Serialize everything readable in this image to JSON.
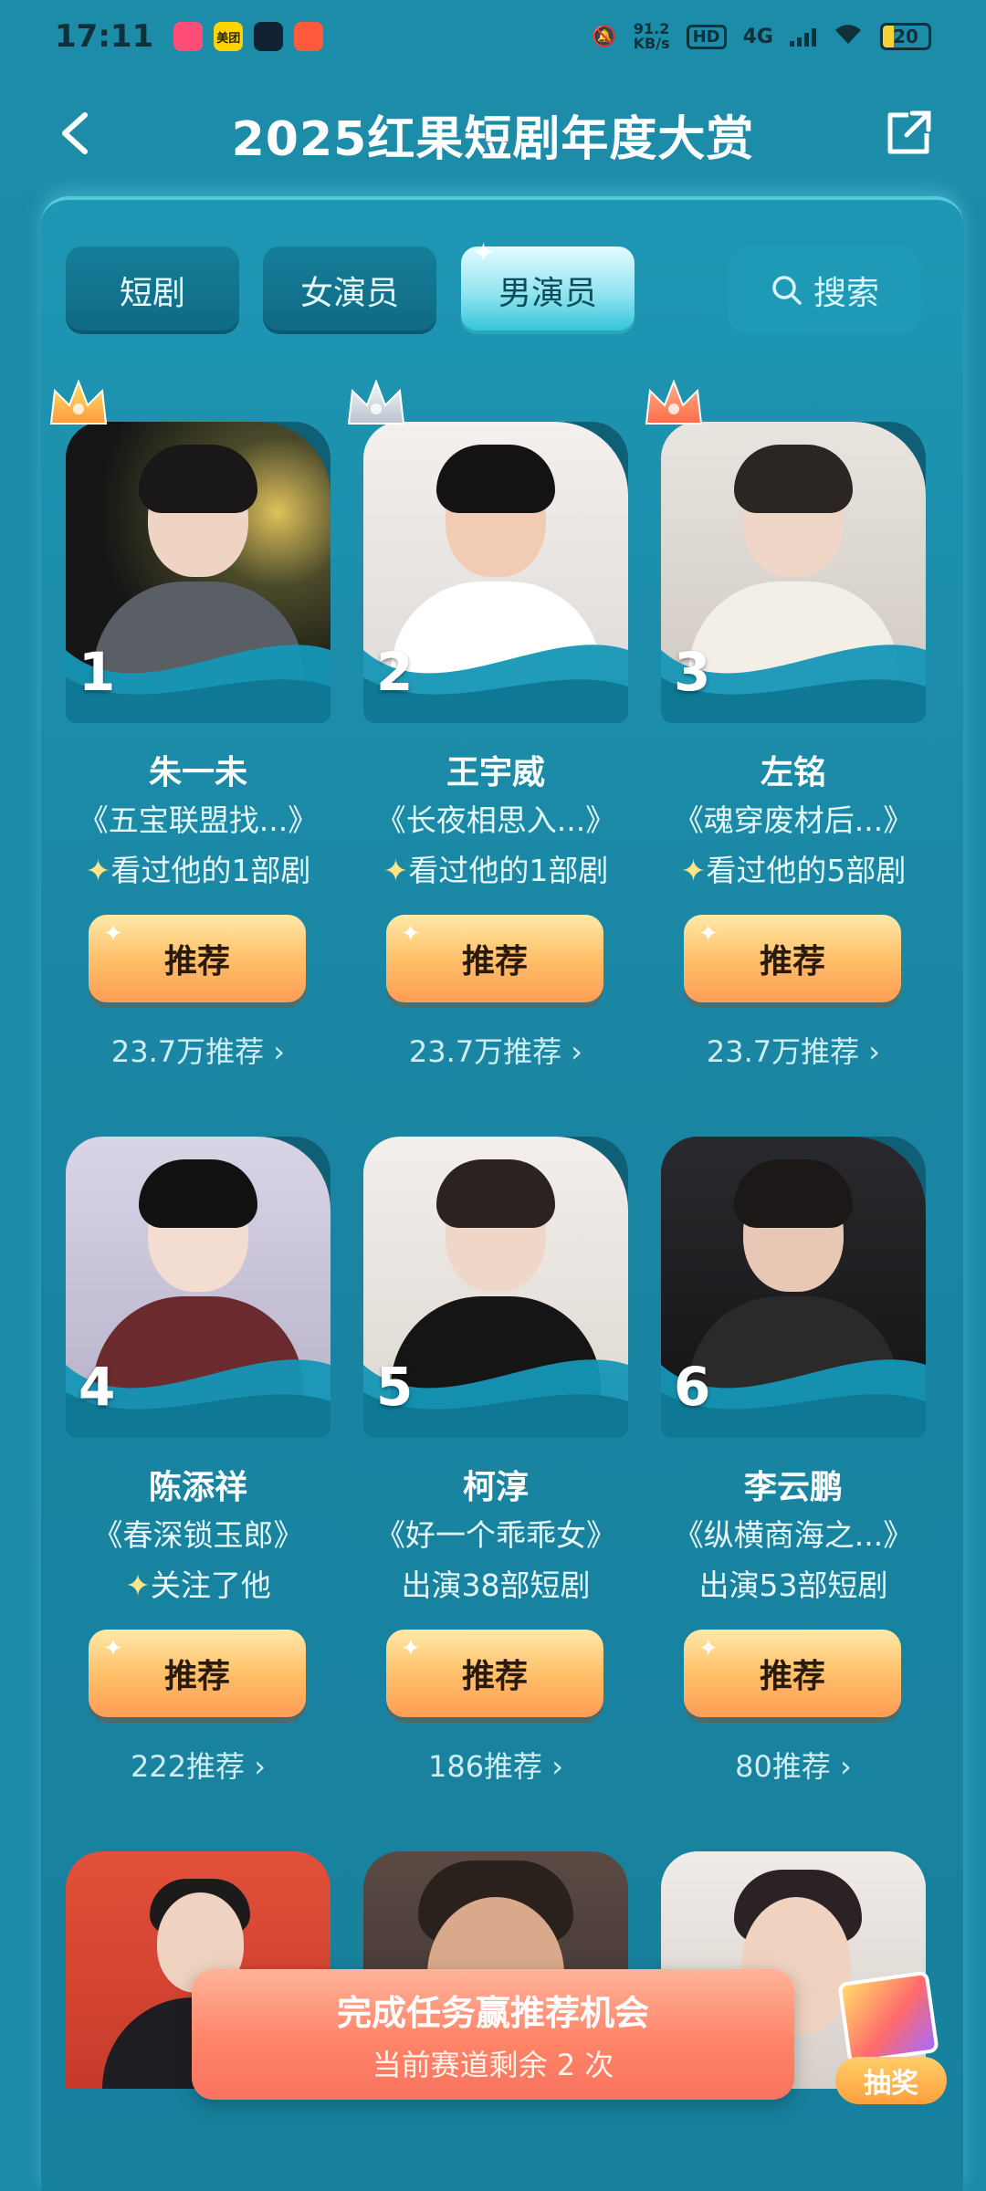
{
  "status_bar": {
    "time": "17:11",
    "app_labels": [
      "",
      "美团",
      "",
      ""
    ],
    "net_speed_value": "91.2",
    "net_speed_unit": "KB/s",
    "hd": "HD",
    "network": "4G",
    "battery": "20"
  },
  "header": {
    "title": "2025红果短剧年度大赏"
  },
  "tabs": [
    {
      "label": "短剧",
      "active": false
    },
    {
      "label": "女演员",
      "active": false
    },
    {
      "label": "男演员",
      "active": true
    }
  ],
  "search": {
    "label": "搜索"
  },
  "actors": [
    {
      "rank": "1",
      "name": "朱一未",
      "drama": "《五宝联盟找...》",
      "note": "看过他的1部剧",
      "note_spark": true,
      "button": "推荐",
      "count": "23.7万推荐 ›",
      "crown": "gold"
    },
    {
      "rank": "2",
      "name": "王宇威",
      "drama": "《长夜相思入...》",
      "note": "看过他的1部剧",
      "note_spark": true,
      "button": "推荐",
      "count": "23.7万推荐 ›",
      "crown": "silver"
    },
    {
      "rank": "3",
      "name": "左铭",
      "drama": "《魂穿废材后...》",
      "note": "看过他的5部剧",
      "note_spark": true,
      "button": "推荐",
      "count": "23.7万推荐 ›",
      "crown": "bronze"
    },
    {
      "rank": "4",
      "name": "陈添祥",
      "drama": "《春深锁玉郎》",
      "note": "关注了他",
      "note_spark": true,
      "button": "推荐",
      "count": "222推荐 ›",
      "crown": ""
    },
    {
      "rank": "5",
      "name": "柯淳",
      "drama": "《好一个乖乖女》",
      "note": "出演38部短剧",
      "note_spark": false,
      "button": "推荐",
      "count": "186推荐 ›",
      "crown": ""
    },
    {
      "rank": "6",
      "name": "李云鹏",
      "drama": "《纵横商海之...》",
      "note": "出演53部短剧",
      "note_spark": false,
      "button": "推荐",
      "count": "80推荐 ›",
      "crown": ""
    }
  ],
  "task_banner": {
    "title": "完成任务赢推荐机会",
    "subtitle": "当前赛道剩余 2 次"
  },
  "lottery": {
    "label": "抽奖"
  },
  "colors": {
    "accent_teal": "#1b8aa6",
    "button_orange": "#ffb463",
    "banner_coral": "#ff8468"
  }
}
